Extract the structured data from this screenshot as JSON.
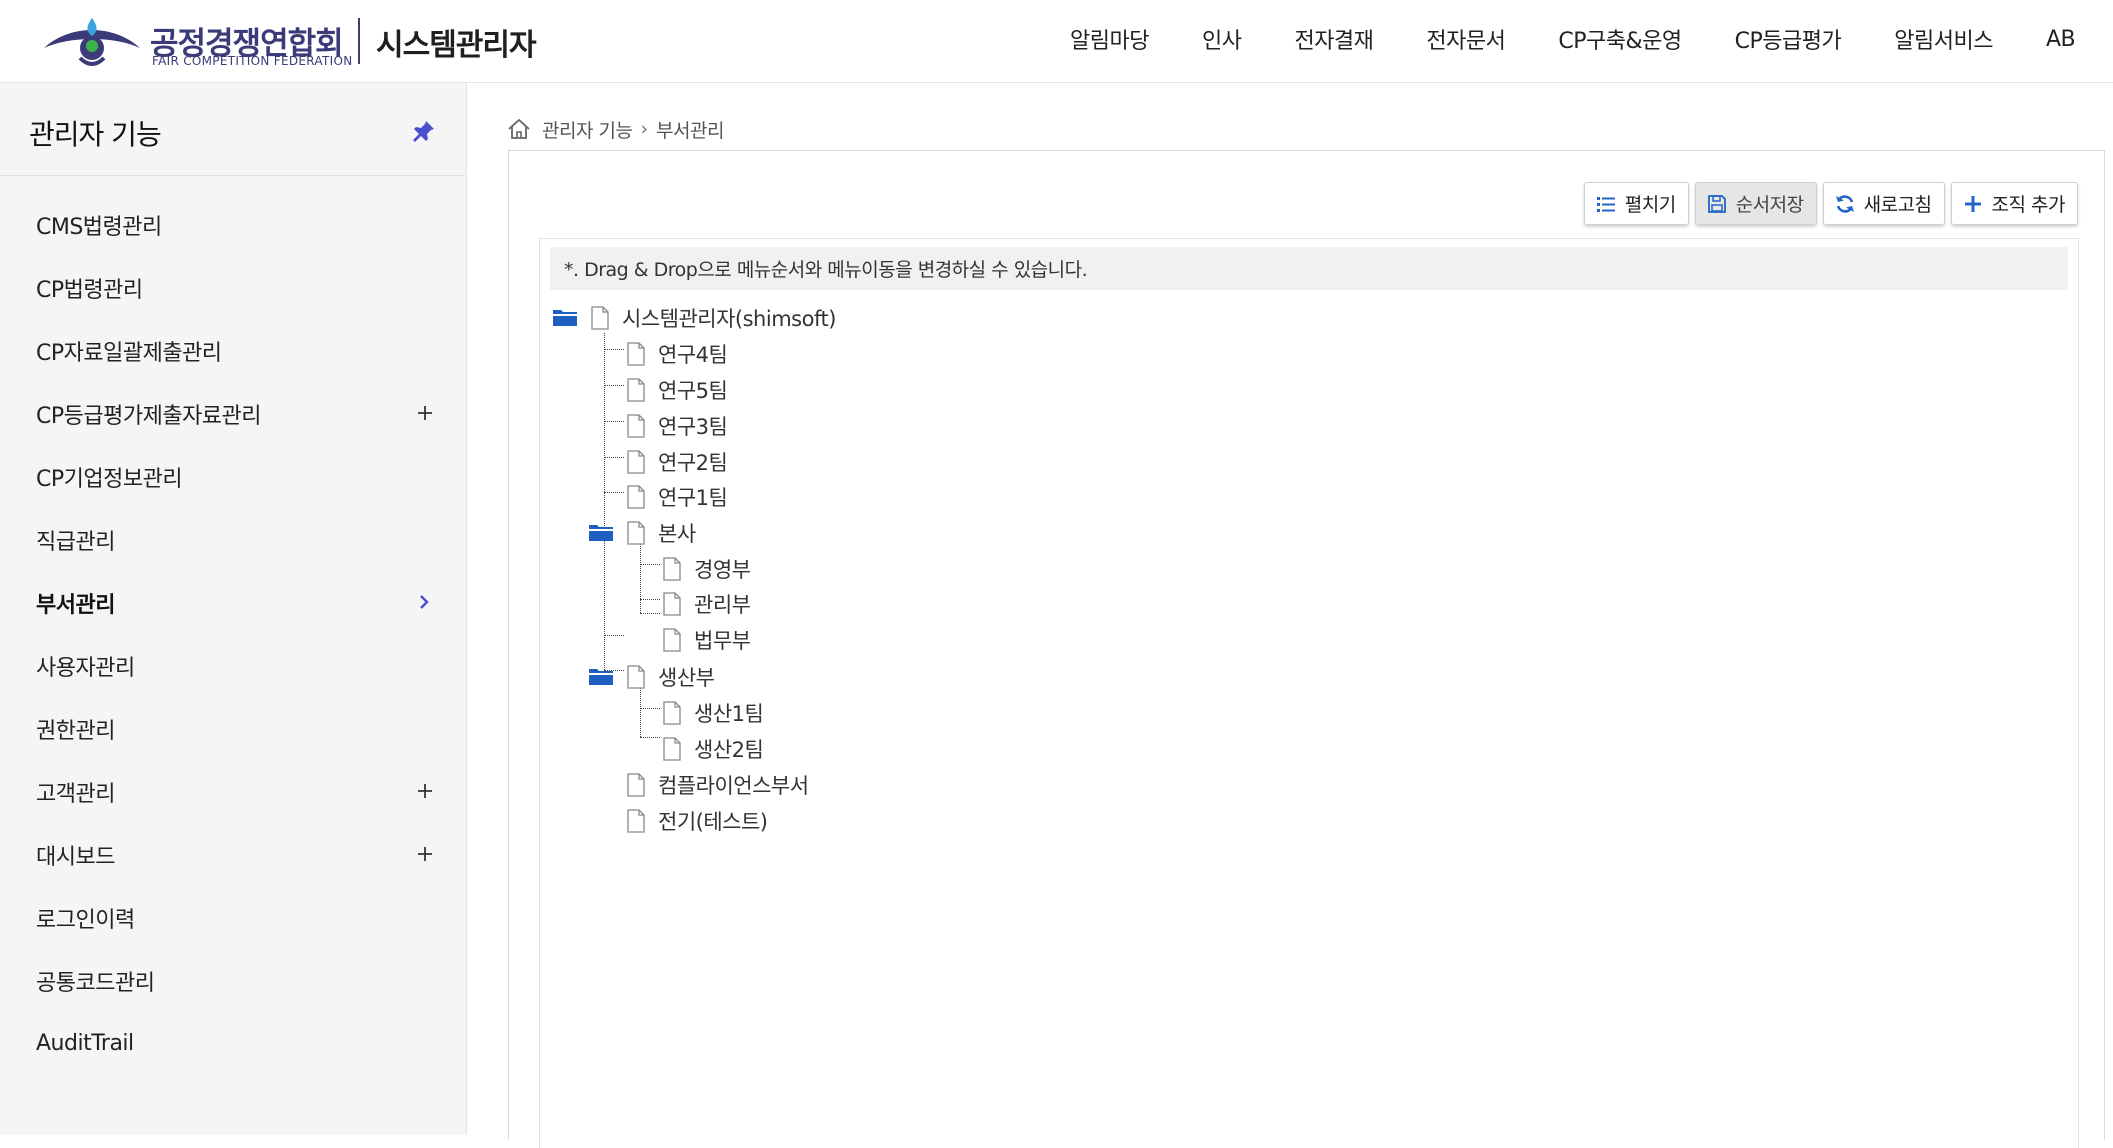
{
  "header": {
    "logo_ko": "공정경쟁연합회",
    "logo_en": "FAIR COMPETITION FEDERATION",
    "app_title": "시스템관리자",
    "nav": [
      "알림마당",
      "인사",
      "전자결재",
      "전자문서",
      "CP구축&운영",
      "CP등급평가",
      "알림서비스",
      "AB"
    ]
  },
  "sidebar": {
    "title": "관리자 기능",
    "items": [
      {
        "label": "CMS법령관리"
      },
      {
        "label": "CP법령관리"
      },
      {
        "label": "CP자료일괄제출관리"
      },
      {
        "label": "CP등급평가제출자료관리"
      },
      {
        "label": "CP기업정보관리"
      },
      {
        "label": "직급관리"
      },
      {
        "label": "부서관리"
      },
      {
        "label": "사용자관리"
      },
      {
        "label": "권한관리"
      },
      {
        "label": "고객관리"
      },
      {
        "label": "대시보드"
      },
      {
        "label": "로그인이력"
      },
      {
        "label": "공통코드관리"
      },
      {
        "label": "AuditTrail"
      }
    ]
  },
  "breadcrumb": {
    "parent": "관리자 기능",
    "current": "부서관리"
  },
  "toolbar": {
    "expand": "펼치기",
    "save_order": "순서저장",
    "refresh": "새로고침",
    "add_org": "조직 추가"
  },
  "notice": "*. Drag & Drop으로 메뉴순서와 메뉴이동을 변경하실 수 있습니다.",
  "tree": {
    "root": "시스템관리자(shimsoft)",
    "nodes": [
      "연구4팀",
      "연구5팀",
      "연구3팀",
      "연구2팀",
      "연구1팀",
      "본사",
      "경영부",
      "관리부",
      "법무부",
      "생산부",
      "생산1팀",
      "생산2팀",
      "컴플라이언스부서",
      "전기(테스트)"
    ]
  },
  "colors": {
    "brand": "#3b3b7a",
    "folder": "#2366c9",
    "pin": "#4a4fd1"
  }
}
